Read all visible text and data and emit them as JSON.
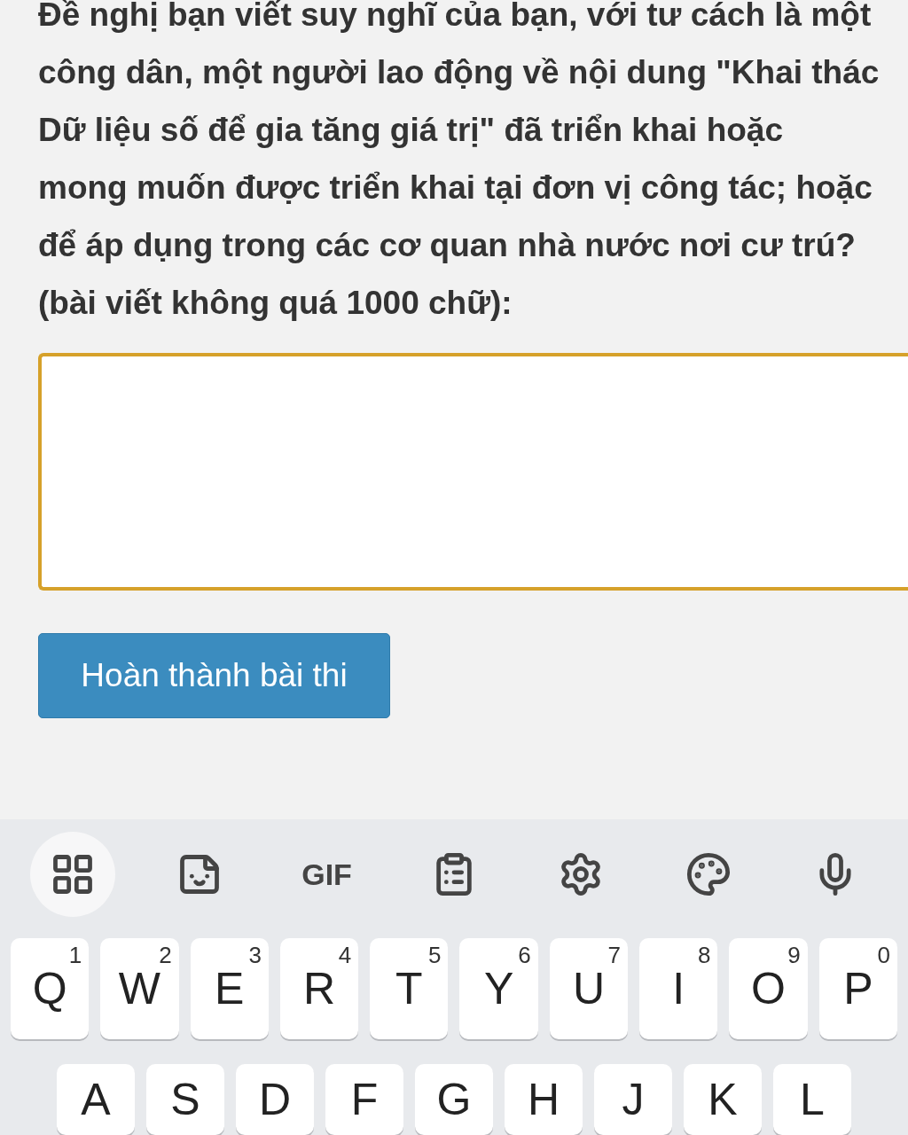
{
  "question": {
    "text": "Đề nghị bạn viết suy nghĩ của bạn, với tư cách là một công dân, một người lao động về nội dung \"Khai thác Dữ liệu số để gia tăng giá trị\" đã triển khai hoặc mong muốn được triển khai tại đơn vị công tác; hoặc để áp dụng trong các cơ quan nhà nước nơi cư trú? (bài viết không quá 1000 chữ):"
  },
  "answer": {
    "focused": true
  },
  "submit_button": {
    "label": "Hoàn thành bài thi"
  },
  "keyboard": {
    "toolbar": [
      {
        "kind": "grid",
        "selected": true
      },
      {
        "kind": "sticker",
        "selected": false
      },
      {
        "kind": "gif",
        "label": "GIF",
        "selected": false
      },
      {
        "kind": "clipboard",
        "selected": false
      },
      {
        "kind": "settings",
        "selected": false
      },
      {
        "kind": "palette",
        "selected": false
      },
      {
        "kind": "mic",
        "selected": false
      }
    ],
    "rows": [
      [
        {
          "key": "Q",
          "hint": "1"
        },
        {
          "key": "W",
          "hint": "2"
        },
        {
          "key": "E",
          "hint": "3"
        },
        {
          "key": "R",
          "hint": "4"
        },
        {
          "key": "T",
          "hint": "5"
        },
        {
          "key": "Y",
          "hint": "6"
        },
        {
          "key": "U",
          "hint": "7"
        },
        {
          "key": "I",
          "hint": "8"
        },
        {
          "key": "O",
          "hint": "9"
        },
        {
          "key": "P",
          "hint": "0"
        }
      ],
      [
        {
          "key": "A"
        },
        {
          "key": "S"
        },
        {
          "key": "D"
        },
        {
          "key": "F"
        },
        {
          "key": "G"
        },
        {
          "key": "H"
        },
        {
          "key": "J"
        },
        {
          "key": "K"
        },
        {
          "key": "L"
        }
      ]
    ]
  }
}
